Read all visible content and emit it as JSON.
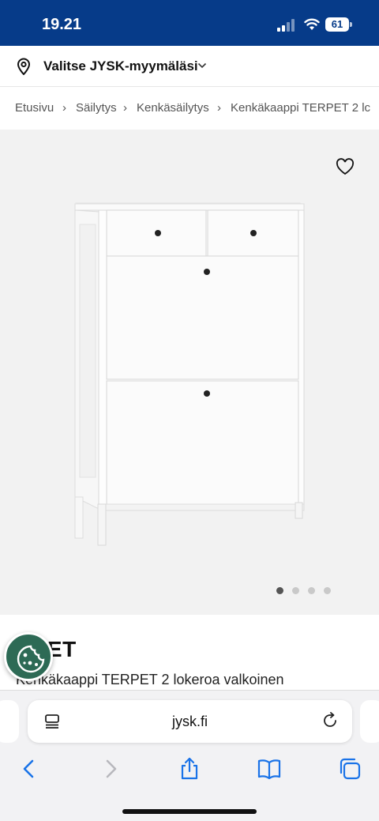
{
  "status": {
    "time": "19.21",
    "battery": "61"
  },
  "store": {
    "label": "Valitse JYSK-myymäläsi",
    "icon": "map-pin-icon"
  },
  "breadcrumb": {
    "items": [
      "Etusivu",
      "Säilytys",
      "Kenkäsäilytys",
      "Kenkäkaappi TERPET 2 lc"
    ],
    "separator": "›"
  },
  "gallery": {
    "image_count": 4,
    "active_index": 0
  },
  "product": {
    "name": "TERPET",
    "name_visible": "RPET",
    "description": "Kenkäkaappi TERPET 2 lokeroa valkoinen"
  },
  "browser": {
    "url": "jysk.fi"
  },
  "colors": {
    "brand": "#063b89",
    "cookie": "#2d6a55"
  }
}
